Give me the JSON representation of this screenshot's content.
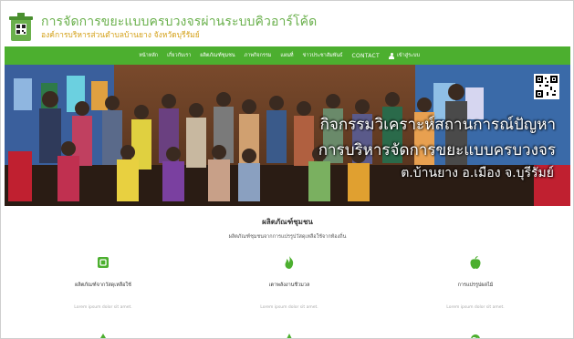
{
  "header": {
    "title": "การจัดการขยะแบบครบวงจรผ่านระบบคิวอาร์โค้ด",
    "subtitle": "องค์การบริหารส่วนตำบลบ้านยาง จังหวัดบุรีรัมย์",
    "logo_icon": "recycle-bin-logo"
  },
  "nav": {
    "items": [
      "หน้าหลัก",
      "เกี่ยวกับเรา",
      "ผลิตภัณฑ์ชุมชน",
      "ภาพกิจกรรม",
      "แผนที่",
      "ข่าวประชาสัมพันธ์",
      "CONTACT"
    ],
    "login_label": "เข้าสู่ระบบ",
    "bg_color": "#4caf2f"
  },
  "hero": {
    "line1": "กิจกรรมวิเคราะห์สถานการณ์ปัญหา",
    "line2": "การบริหารจัดการขยะแบบครบวงจร",
    "line3": "ต.บ้านยาง อ.เมือง จ.บุรีรัมย์"
  },
  "products": {
    "title": "ผลิตภัณฑ์ชุมชน",
    "subtitle": "ผลิตภัณฑ์ชุมชนจากการแปรรูปวัสดุเหลือใช้จากท้องถิ่น",
    "items": [
      {
        "label": "ผลิตภัณฑ์จากวัสดุเหลือใช้",
        "desc": "Lorem ipsum dolor sit amet.",
        "icon": "box-icon"
      },
      {
        "label": "เตาพลังงานชีวมวล",
        "desc": "Lorem ipsum dolor sit amet.",
        "icon": "fire-icon"
      },
      {
        "label": "การแปรรูปผลไม้",
        "desc": "Lorem ipsum dolor sit amet.",
        "icon": "apple-icon"
      }
    ]
  },
  "colors": {
    "accent": "#4caf2f",
    "title_green": "#6ab04c",
    "subtitle_gold": "#d4a017"
  }
}
